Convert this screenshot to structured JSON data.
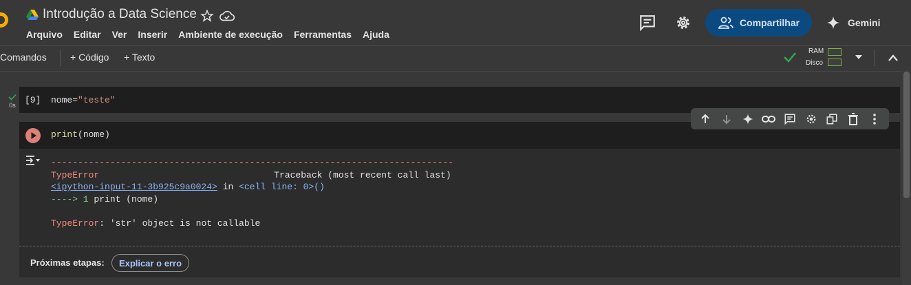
{
  "header": {
    "title": "Introdução a Data Science",
    "menu": [
      "Arquivo",
      "Editar",
      "Ver",
      "Inserir",
      "Ambiente de execução",
      "Ferramentas",
      "Ajuda"
    ],
    "share_label": "Compartilhar",
    "gemini_label": "Gemini"
  },
  "toolbar": {
    "commands_label": "Comandos",
    "code_label": "+ Código",
    "text_label": "+ Texto",
    "ram_label": "RAM",
    "disk_label": "Disco"
  },
  "cells": {
    "cell1": {
      "status": "0s",
      "exec_count": "[9]",
      "code_prefix": "nome=",
      "code_string": "\"teste\""
    },
    "cell2": {
      "code_fn": "print",
      "code_rest": "(nome)"
    }
  },
  "output": {
    "dashes": "---------------------------------------------------------------------------",
    "error_name": "TypeError",
    "traceback_label": "Traceback (most recent call last)",
    "input_link": "<ipython-input-11-3b925c9a0024>",
    "in_word": " in ",
    "cell_line": "<cell line: 0>()",
    "arrow": "----> 1",
    "arrow_code": " print (nome)",
    "error_msg": ": 'str' object is not callable",
    "next_steps_label": "Próximas etapas:",
    "explain_label": "Explicar o erro"
  },
  "colors": {
    "accent_share": "#0b4a80",
    "error": "#f28b82",
    "link": "#8ab4f8",
    "ok": "#34a853"
  }
}
